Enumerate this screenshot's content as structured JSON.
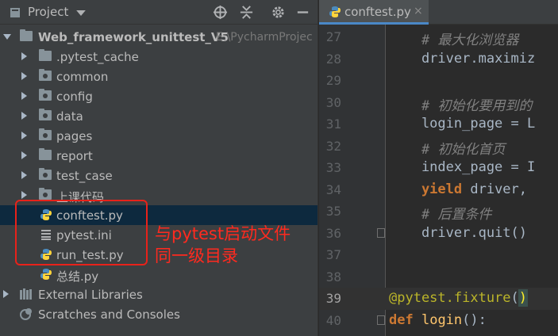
{
  "project_panel": {
    "title": "Project",
    "tools": {
      "locate": "⊕",
      "collapse": "÷",
      "settings": "⚙",
      "hide": "—"
    },
    "root": {
      "name": "Web_framework_unittest_V5",
      "path": "E:\\PycharmProjec"
    },
    "items": [
      {
        "label": "pytest_cache",
        "prefix": ".",
        "type": "folder"
      },
      {
        "label": "common",
        "type": "package"
      },
      {
        "label": "config",
        "type": "package"
      },
      {
        "label": "data",
        "type": "package"
      },
      {
        "label": "pages",
        "type": "package"
      },
      {
        "label": "report",
        "type": "folder"
      },
      {
        "label": "test_case",
        "type": "package"
      },
      {
        "label": "上课代码",
        "type": "folder"
      }
    ],
    "files": [
      {
        "label": "conftest.py",
        "type": "python"
      },
      {
        "label": "pytest.ini",
        "type": "ini"
      },
      {
        "label": "run_test.py",
        "type": "python"
      },
      {
        "label": "总结.py",
        "type": "python"
      }
    ],
    "external_libraries": "External Libraries",
    "scratches": "Scratches and Consoles"
  },
  "annotation": {
    "line1": "与pytest启动文件",
    "line2": "同一级目录",
    "color": "#ff2a1f"
  },
  "editor": {
    "tab": {
      "label": "conftest.py",
      "close": "×"
    },
    "lines": [
      {
        "n": "27",
        "parts": [
          [
            "c-comment",
            "    # 最大化浏览器"
          ]
        ]
      },
      {
        "n": "28",
        "parts": [
          [
            "",
            "    driver."
          ],
          [
            "c-meth",
            "maximiz"
          ]
        ]
      },
      {
        "n": "29",
        "parts": []
      },
      {
        "n": "30",
        "parts": [
          [
            "c-comment",
            "    # 初始化要用到的"
          ]
        ]
      },
      {
        "n": "31",
        "parts": [
          [
            "",
            "    login_page = L"
          ]
        ]
      },
      {
        "n": "32",
        "parts": [
          [
            "c-comment",
            "    # 初始化首页"
          ]
        ]
      },
      {
        "n": "33",
        "parts": [
          [
            "",
            "    index_page = I"
          ]
        ]
      },
      {
        "n": "34",
        "parts": [
          [
            "c-keyword",
            "    yield"
          ],
          [
            "",
            " driver,"
          ]
        ]
      },
      {
        "n": "35",
        "parts": [
          [
            "c-comment",
            "    # 后置条件"
          ]
        ]
      },
      {
        "n": "36",
        "parts": [
          [
            "",
            "    driver."
          ],
          [
            "c-meth",
            "quit"
          ],
          [
            "",
            "()"
          ]
        ]
      },
      {
        "n": "37",
        "parts": []
      },
      {
        "n": "38",
        "parts": []
      },
      {
        "n": "39",
        "parts": [
          [
            "c-decorator",
            "@pytest.fixture"
          ],
          [
            "",
            "("
          ],
          [
            "paren-hl",
            ")"
          ]
        ]
      },
      {
        "n": "40",
        "parts": [
          [
            "c-keyword",
            "def"
          ],
          [
            "",
            " "
          ],
          [
            "c-func",
            "login"
          ],
          [
            "",
            "():"
          ]
        ]
      }
    ]
  }
}
